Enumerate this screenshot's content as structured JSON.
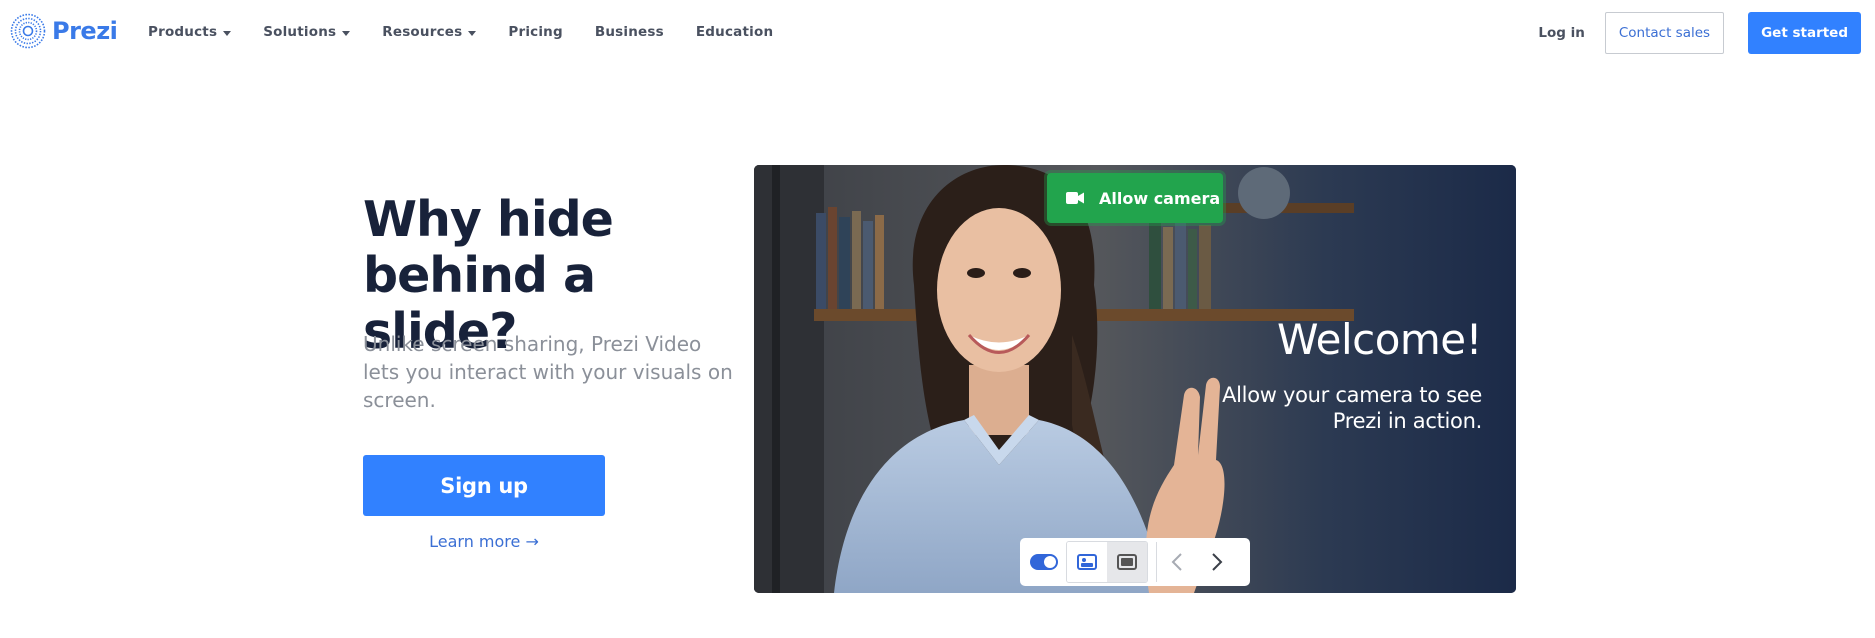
{
  "nav": {
    "logo_text": "Prezi",
    "items": [
      {
        "label": "Products",
        "dropdown": true
      },
      {
        "label": "Solutions",
        "dropdown": true
      },
      {
        "label": "Resources",
        "dropdown": true
      },
      {
        "label": "Pricing",
        "dropdown": false
      },
      {
        "label": "Business",
        "dropdown": false
      },
      {
        "label": "Education",
        "dropdown": false
      }
    ],
    "login_label": "Log in",
    "contact_label": "Contact sales",
    "get_started_label": "Get started"
  },
  "hero": {
    "title": "Why hide behind a slide?",
    "subtitle": "Unlike screen sharing, Prezi Video lets you interact with your visuals on screen.",
    "signup_label": "Sign up",
    "learn_more_label": "Learn more →"
  },
  "video": {
    "allow_camera_label": "Allow camera",
    "welcome_text": "Welcome!",
    "allow_text": "Allow your camera to see Prezi in action.",
    "toolbar": {
      "toggle_on": true,
      "icons": [
        "toggle-icon",
        "picture-in-picture-icon",
        "fullscreen-layout-icon",
        "chevron-left-icon",
        "chevron-right-icon"
      ]
    }
  },
  "colors": {
    "brand_blue": "#3181ff",
    "link_blue": "#3b6fd4",
    "camera_green": "#22a44d",
    "heading": "#18223a"
  }
}
